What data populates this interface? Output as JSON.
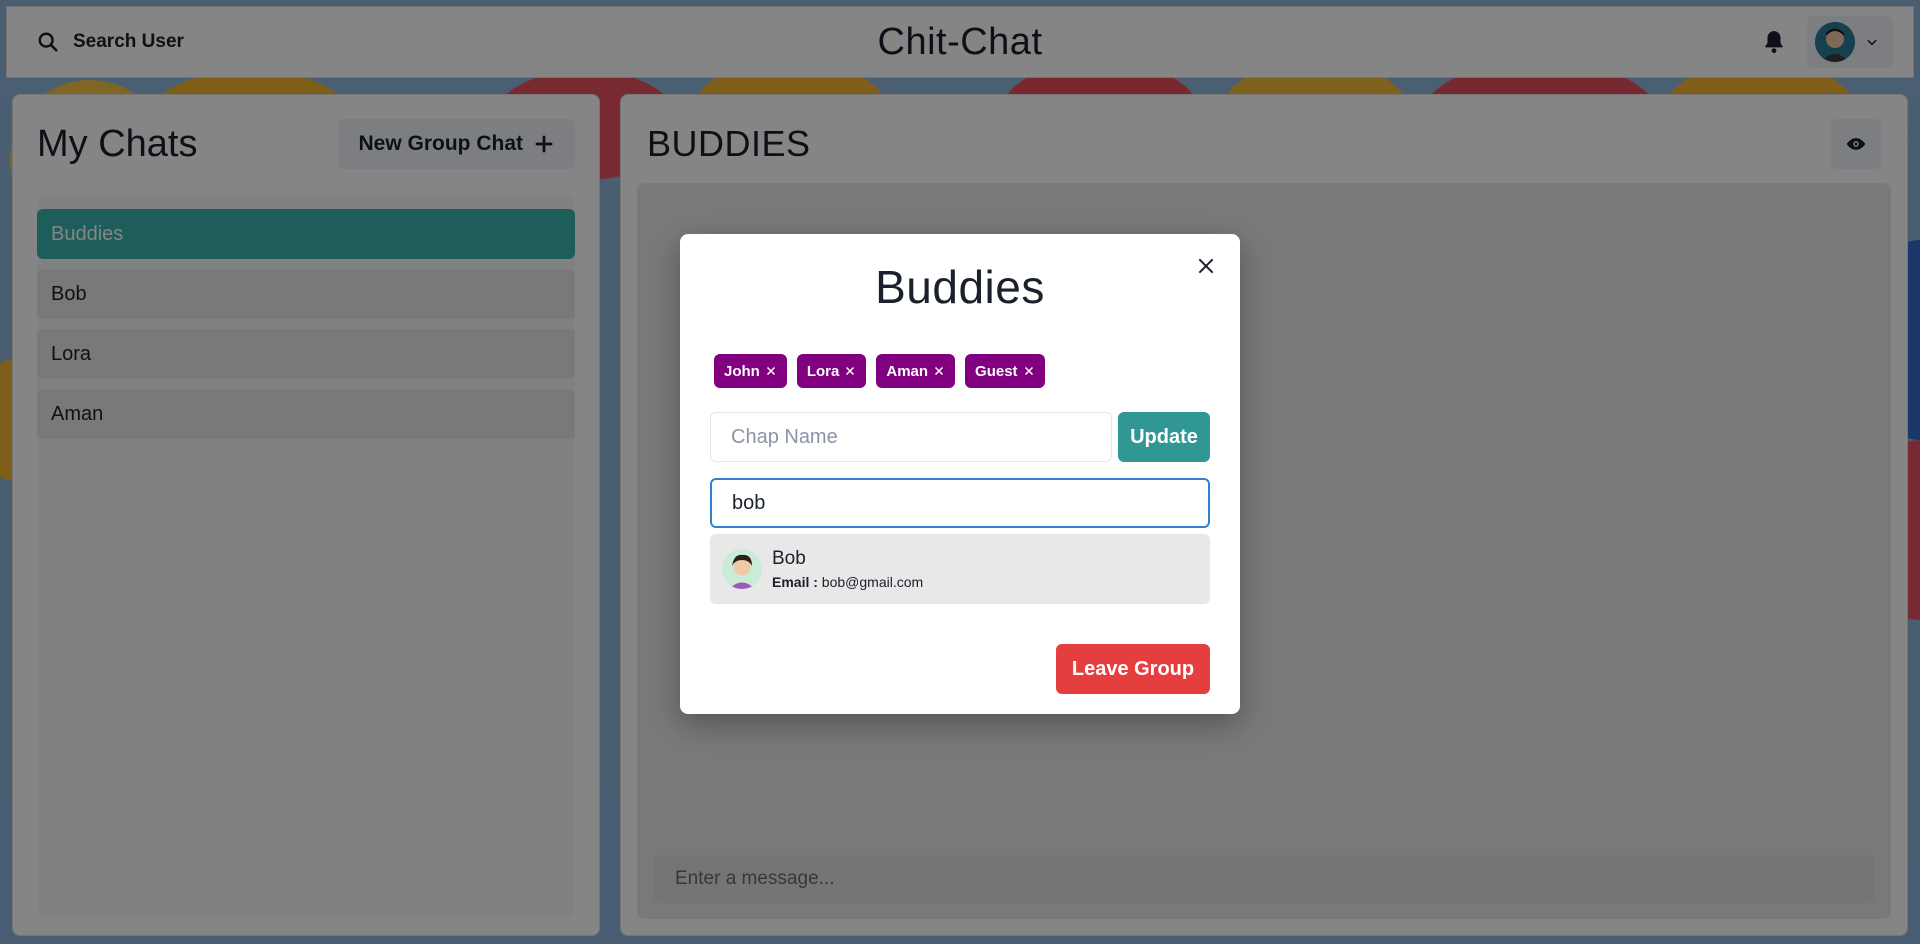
{
  "header": {
    "search_label": "Search User",
    "app_title": "Chit-Chat"
  },
  "sidebar": {
    "title": "My Chats",
    "new_group_label": "New Group Chat",
    "chats": [
      {
        "label": "Buddies",
        "active": true
      },
      {
        "label": "Bob",
        "active": false
      },
      {
        "label": "Lora",
        "active": false
      },
      {
        "label": "Aman",
        "active": false
      }
    ]
  },
  "chat": {
    "title": "BUDDIES",
    "message_placeholder": "Enter a message..."
  },
  "modal": {
    "title": "Buddies",
    "members": [
      "John",
      "Lora",
      "Aman",
      "Guest"
    ],
    "rename_placeholder": "Chap Name",
    "update_label": "Update",
    "search_value": "bob",
    "results": [
      {
        "name": "Bob",
        "email_label": "Email :",
        "email": "bob@gmail.com"
      }
    ],
    "leave_label": "Leave Group"
  },
  "colors": {
    "accent": "#38b2ac",
    "chip": "#800080",
    "danger": "#e53e3e",
    "update": "#319795"
  }
}
